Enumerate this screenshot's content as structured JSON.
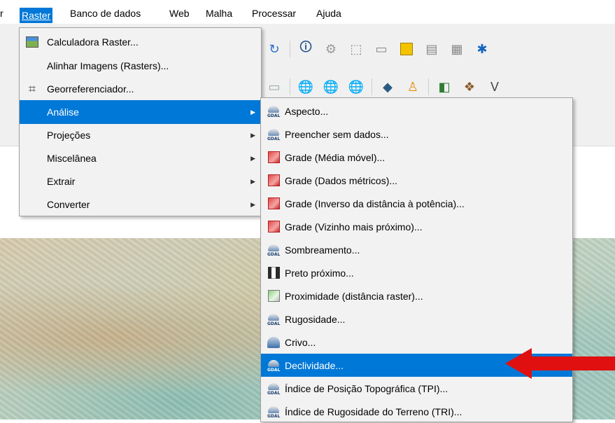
{
  "menubar": {
    "items": [
      {
        "key": "cut",
        "label": "r"
      },
      {
        "key": "raster",
        "label": "Raster"
      },
      {
        "key": "db",
        "label": "Banco de dados"
      },
      {
        "key": "web",
        "label": "Web"
      },
      {
        "key": "mesh",
        "label": "Malha"
      },
      {
        "key": "proc",
        "label": "Processar"
      },
      {
        "key": "help",
        "label": "Ajuda"
      }
    ]
  },
  "raster_menu": {
    "items": [
      {
        "label": "Calculadora Raster...",
        "icon": "calculator-raster-icon"
      },
      {
        "label": "Alinhar Imagens (Rasters)...",
        "icon": ""
      },
      {
        "label": "Georreferenciador...",
        "icon": "georeferencer-icon"
      },
      {
        "label": "Análise",
        "submenu": true,
        "selected": true
      },
      {
        "label": "Projeções",
        "submenu": true
      },
      {
        "label": "Miscelânea",
        "submenu": true
      },
      {
        "label": "Extrair",
        "submenu": true
      },
      {
        "label": "Converter",
        "submenu": true
      }
    ]
  },
  "analysis_menu": {
    "items": [
      {
        "label": "Aspecto...",
        "icon": "gdal-icon"
      },
      {
        "label": "Preencher sem dados...",
        "icon": "gdal-icon"
      },
      {
        "label": "Grade (Média móvel)...",
        "icon": "grid-icon"
      },
      {
        "label": "Grade (Dados métricos)...",
        "icon": "grid-icon"
      },
      {
        "label": "Grade (Inverso da distância à potência)...",
        "icon": "grid-icon"
      },
      {
        "label": "Grade (Vizinho mais próximo)...",
        "icon": "grid-icon"
      },
      {
        "label": "Sombreamento...",
        "icon": "gdal-icon"
      },
      {
        "label": "Preto próximo...",
        "icon": "nearblack-icon"
      },
      {
        "label": "Proximidade (distância raster)...",
        "icon": "proximity-icon"
      },
      {
        "label": "Rugosidade...",
        "icon": "gdal-icon"
      },
      {
        "label": "Crivo...",
        "icon": "sieve-icon"
      },
      {
        "label": "Declividade...",
        "icon": "gdal-icon",
        "selected": true
      },
      {
        "label": "Índice de Posição Topográfica (TPI)...",
        "icon": "gdal-icon"
      },
      {
        "label": "Índice de Rugosidade do Terreno (TRI)...",
        "icon": "gdal-icon"
      }
    ]
  },
  "gdal_text": "GDAL",
  "colors": {
    "selection": "#0078d7",
    "annotation_arrow": "#e01010",
    "menu_bg": "#f2f2f2"
  }
}
